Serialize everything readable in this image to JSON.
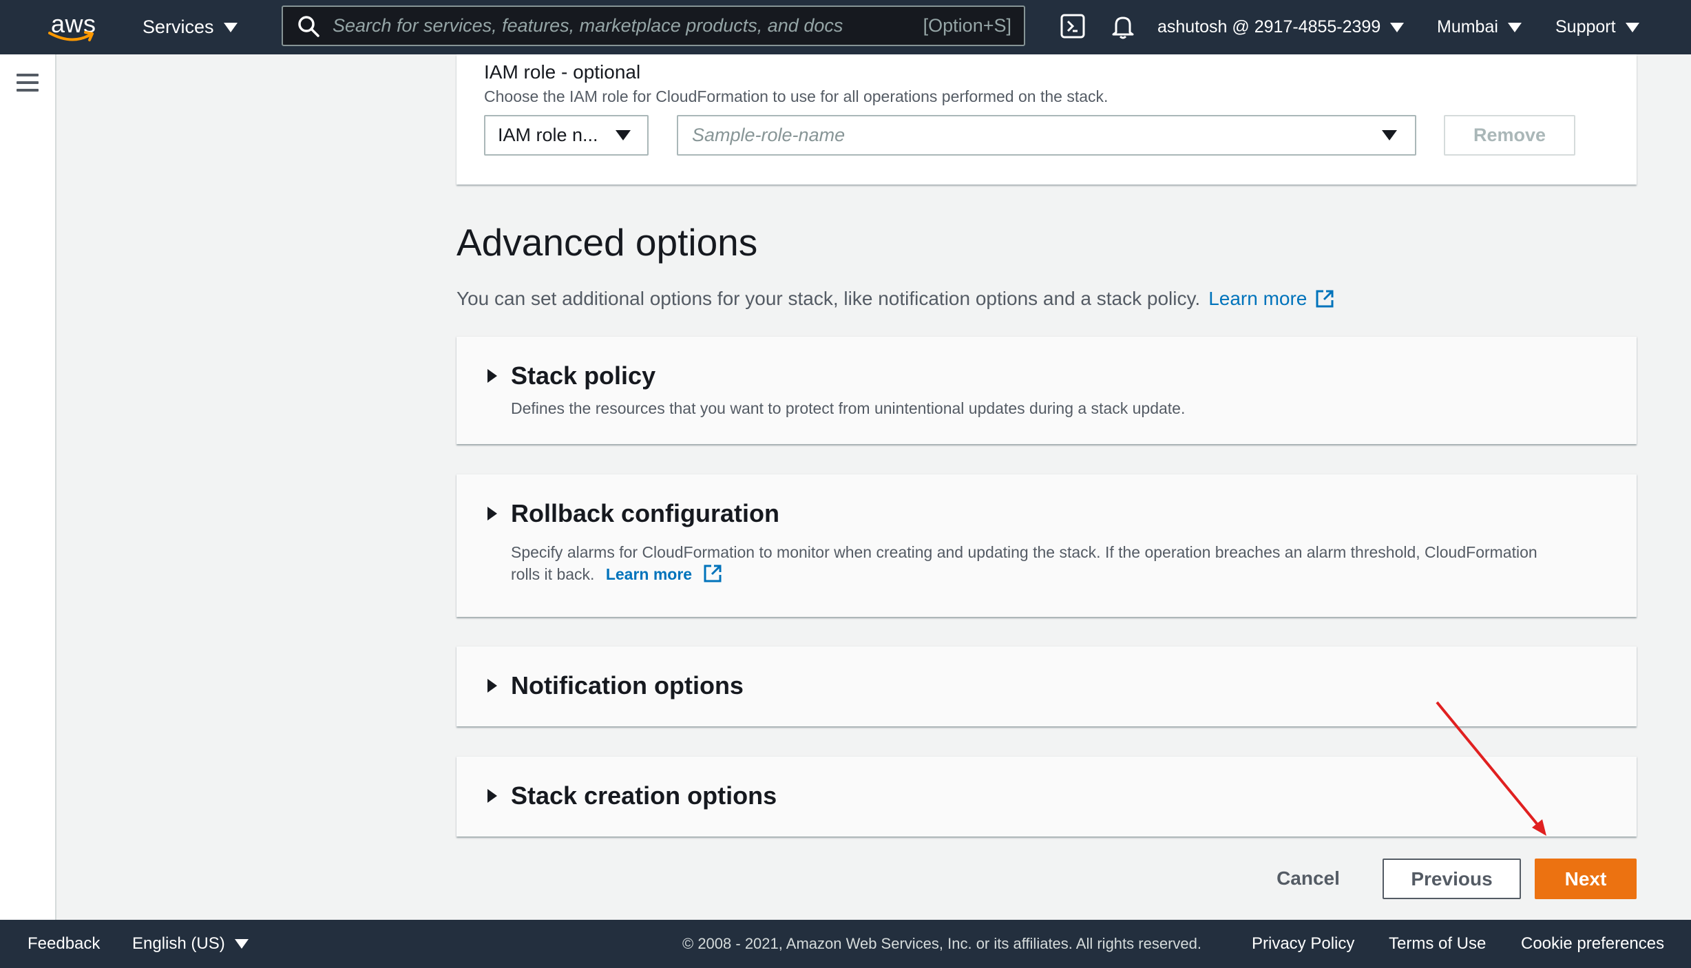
{
  "topnav": {
    "logo": "aws",
    "services_label": "Services",
    "search_placeholder": "Search for services, features, marketplace products, and docs",
    "search_shortcut": "[Option+S]",
    "account": "ashutosh @ 2917-4855-2399",
    "region": "Mumbai",
    "support": "Support",
    "icons": [
      "cloudshell-icon",
      "bell-icon"
    ]
  },
  "iam_role": {
    "title": "IAM role - optional",
    "description": "Choose the IAM role for CloudFormation to use for all operations performed on the stack.",
    "select_value": "IAM role n...",
    "input_placeholder": "Sample-role-name",
    "remove_label": "Remove"
  },
  "advanced": {
    "title": "Advanced options",
    "description": "You can set additional options for your stack, like notification options and a stack policy.",
    "learn_more": "Learn more"
  },
  "sections": [
    {
      "title": "Stack policy",
      "description": "Defines the resources that you want to protect from unintentional updates during a stack update."
    },
    {
      "title": "Rollback configuration",
      "description": "Specify alarms for CloudFormation to monitor when creating and updating the stack. If the operation breaches an alarm threshold, CloudFormation rolls it back.",
      "learn_more": "Learn more"
    },
    {
      "title": "Notification options"
    },
    {
      "title": "Stack creation options"
    }
  ],
  "actions": {
    "cancel": "Cancel",
    "previous": "Previous",
    "next": "Next"
  },
  "footer": {
    "feedback": "Feedback",
    "language": "English (US)",
    "copyright": "© 2008 - 2021, Amazon Web Services, Inc. or its affiliates. All rights reserved.",
    "privacy": "Privacy Policy",
    "terms": "Terms of Use",
    "cookies": "Cookie preferences"
  },
  "colors": {
    "nav_bg": "#232f3e",
    "primary": "#ec7211",
    "link": "#0073bb",
    "annotation_arrow": "#e02020"
  }
}
